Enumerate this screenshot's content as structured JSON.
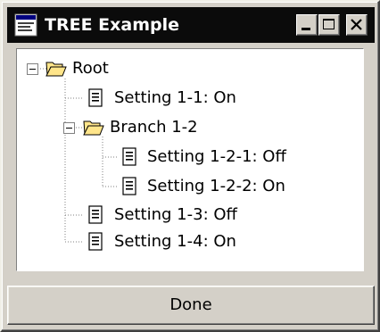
{
  "window": {
    "title": "TREE Example",
    "title_icon": "window-app-icon",
    "controls": [
      "minimize-icon",
      "maximize-icon",
      "close-icon"
    ]
  },
  "tree": {
    "root": {
      "label": "Root",
      "expanded": true,
      "icon": "open-folder-icon",
      "children": [
        {
          "label": "Setting 1-1: On",
          "icon": "document-icon"
        },
        {
          "label": "Branch 1-2",
          "expanded": true,
          "icon": "open-folder-icon",
          "children": [
            {
              "label": "Setting 1-2-1: Off",
              "icon": "document-icon"
            },
            {
              "label": "Setting 1-2-2: On",
              "icon": "document-icon"
            }
          ]
        },
        {
          "label": "Setting 1-3: Off",
          "icon": "document-icon"
        },
        {
          "label": "Setting 1-4: On",
          "icon": "document-icon"
        }
      ]
    }
  },
  "done_button": {
    "label": "Done"
  },
  "colors": {
    "titlebar": "#0b0b0b",
    "face": "#d4d0c8",
    "folder": "#ffe58a",
    "tree_bg": "#ffffff"
  }
}
